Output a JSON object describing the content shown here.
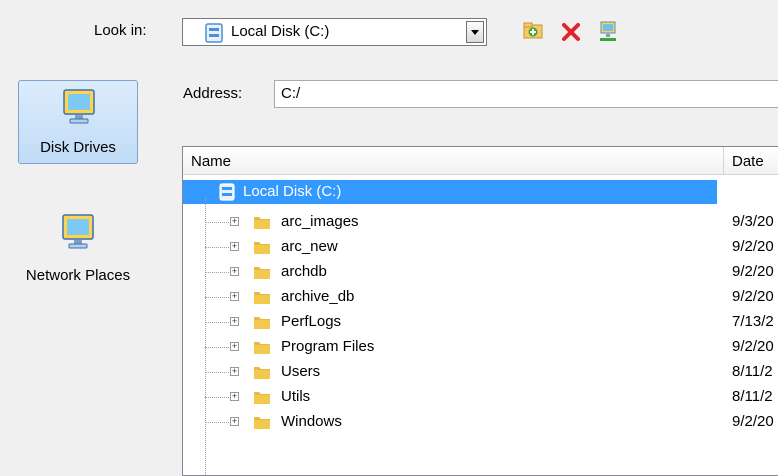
{
  "look_in": {
    "label": "Look in:",
    "value": "Local Disk (C:)"
  },
  "toolbar": {
    "icons": [
      "new-folder-icon",
      "delete-icon",
      "network-drive-icon"
    ]
  },
  "places": [
    {
      "label": "Disk Drives",
      "icon": "computer-icon",
      "selected": true
    },
    {
      "label": "Network Places",
      "icon": "network-computer-icon",
      "selected": false
    }
  ],
  "address": {
    "label": "Address:",
    "value": "C:/"
  },
  "list": {
    "columns": {
      "name": "Name",
      "date": "Date"
    },
    "root": {
      "name": "Local Disk (C:)"
    },
    "items": [
      {
        "name": "arc_images",
        "date": "9/3/20"
      },
      {
        "name": "arc_new",
        "date": "9/2/20"
      },
      {
        "name": "archdb",
        "date": "9/2/20"
      },
      {
        "name": "archive_db",
        "date": "9/2/20"
      },
      {
        "name": "PerfLogs",
        "date": "7/13/2"
      },
      {
        "name": "Program Files",
        "date": "9/2/20"
      },
      {
        "name": "Users",
        "date": "8/11/2"
      },
      {
        "name": "Utils",
        "date": "8/11/2"
      },
      {
        "name": "Windows",
        "date": "9/2/20"
      }
    ]
  },
  "colors": {
    "selection": "#3399ff",
    "folder": "#f2c94c",
    "accent_border": "#7da2ce"
  }
}
